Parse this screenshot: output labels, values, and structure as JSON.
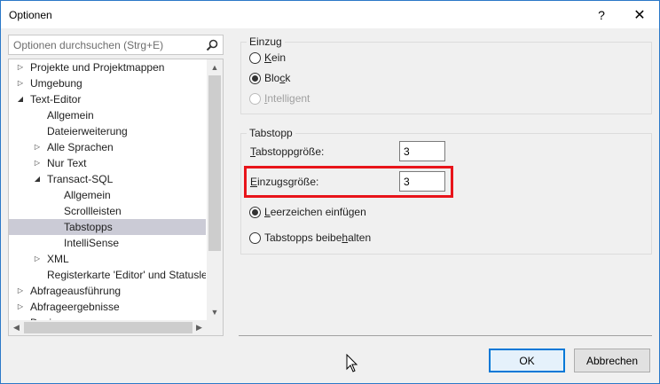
{
  "window": {
    "title": "Optionen",
    "help_glyph": "?",
    "close_glyph": "✕"
  },
  "search": {
    "placeholder": "Optionen durchsuchen (Strg+E)",
    "icon": "search-icon"
  },
  "tree": {
    "items": [
      {
        "label": "Projekte und Projektmappen",
        "level": 0,
        "arrow": "collapsed"
      },
      {
        "label": "Umgebung",
        "level": 0,
        "arrow": "collapsed"
      },
      {
        "label": "Text-Editor",
        "level": 0,
        "arrow": "expanded"
      },
      {
        "label": "Allgemein",
        "level": 1,
        "arrow": "none"
      },
      {
        "label": "Dateierweiterung",
        "level": 1,
        "arrow": "none"
      },
      {
        "label": "Alle Sprachen",
        "level": 1,
        "arrow": "collapsed"
      },
      {
        "label": "Nur Text",
        "level": 1,
        "arrow": "collapsed"
      },
      {
        "label": "Transact-SQL",
        "level": 1,
        "arrow": "expanded"
      },
      {
        "label": "Allgemein",
        "level": 2,
        "arrow": "none"
      },
      {
        "label": "Scrollleisten",
        "level": 2,
        "arrow": "none"
      },
      {
        "label": "Tabstopps",
        "level": 2,
        "arrow": "none",
        "selected": true
      },
      {
        "label": "IntelliSense",
        "level": 2,
        "arrow": "none"
      },
      {
        "label": "XML",
        "level": 1,
        "arrow": "collapsed"
      },
      {
        "label": "Registerkarte 'Editor' und Statuslei",
        "level": 1,
        "arrow": "none"
      },
      {
        "label": "Abfrageausführung",
        "level": 0,
        "arrow": "collapsed"
      },
      {
        "label": "Abfrageergebnisse",
        "level": 0,
        "arrow": "collapsed"
      },
      {
        "label": "Designer",
        "level": 0,
        "arrow": "collapsed"
      }
    ]
  },
  "einzug": {
    "title": "Einzug",
    "options": [
      {
        "pre": "",
        "key": "K",
        "post": "ein",
        "checked": false,
        "disabled": false
      },
      {
        "pre": "Blo",
        "key": "c",
        "post": "k",
        "checked": true,
        "disabled": false
      },
      {
        "pre": "",
        "key": "I",
        "post": "ntelligent",
        "checked": false,
        "disabled": true
      }
    ]
  },
  "tabstopp": {
    "title": "Tabstopp",
    "tab_size_label": {
      "pre": "",
      "key": "T",
      "post": "abstoppgröße:"
    },
    "tab_size_value": "3",
    "indent_size_label": {
      "pre": "",
      "key": "E",
      "post": "inzugsgröße:"
    },
    "indent_size_value": "3",
    "options": [
      {
        "pre": "",
        "key": "L",
        "post": "eerzeichen einfügen",
        "checked": true
      },
      {
        "pre": "Tabstopps beibe",
        "key": "h",
        "post": "alten",
        "checked": false
      }
    ]
  },
  "buttons": {
    "ok": "OK",
    "cancel": "Abbrechen"
  },
  "colors": {
    "highlight": "#e8141a",
    "accent": "#0078d7",
    "selection": "#cbcbd6"
  }
}
